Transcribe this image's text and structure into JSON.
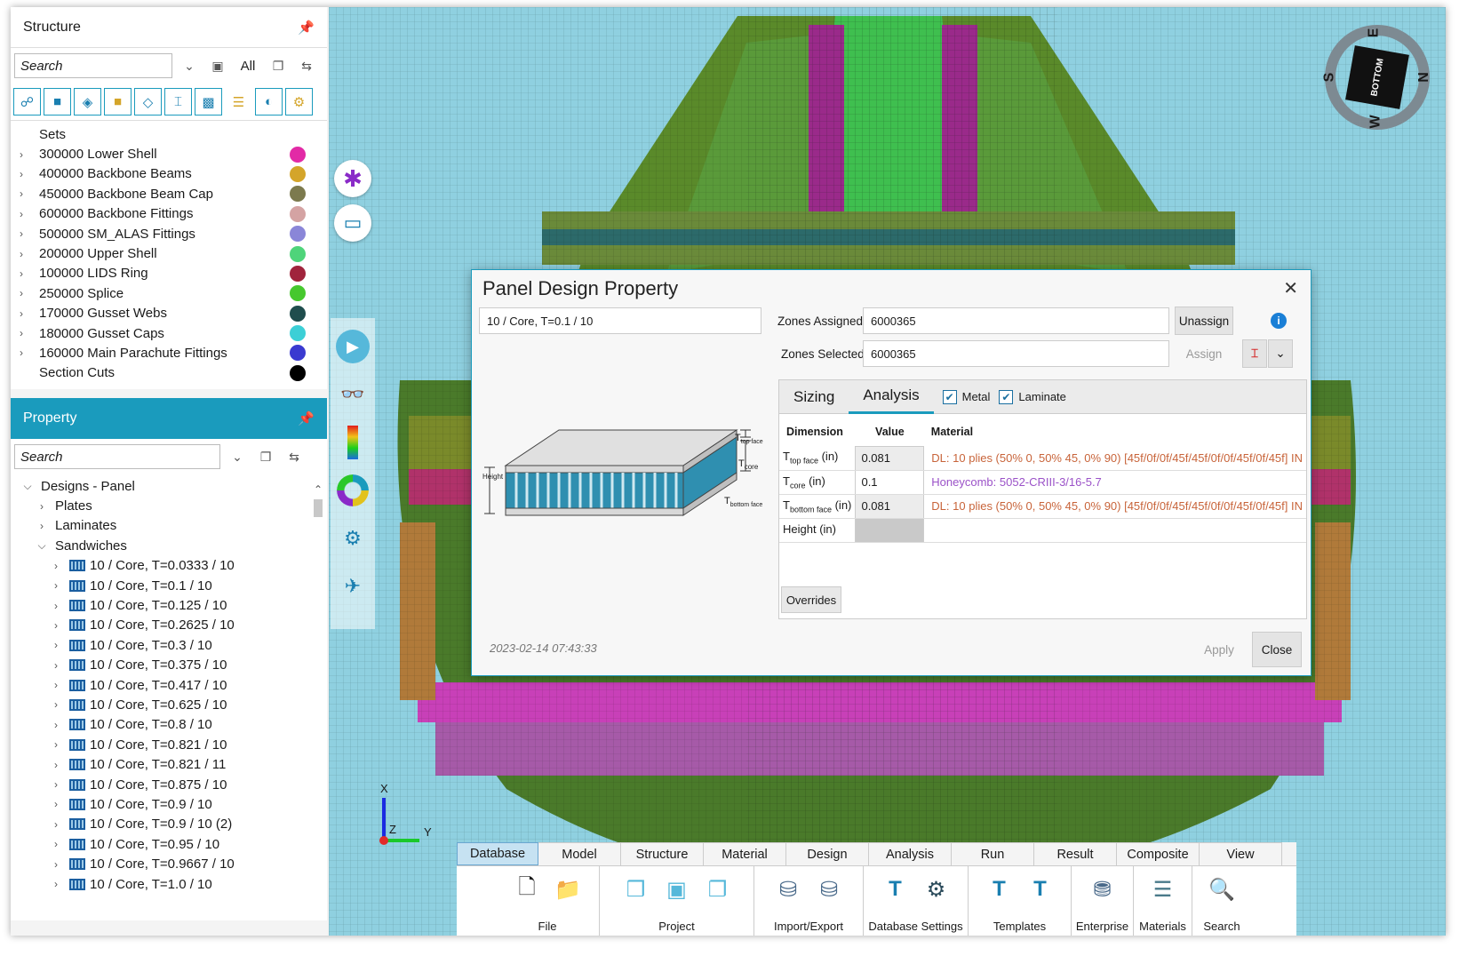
{
  "structure": {
    "title": "Structure",
    "search_placeholder": "Search",
    "all_label": "All",
    "sets_root": "Sets",
    "sets": [
      {
        "label": "300000 Lower Shell",
        "color": "#e22aa6"
      },
      {
        "label": "400000 Backbone Beams",
        "color": "#d4a52a"
      },
      {
        "label": "450000 Backbone Beam Cap",
        "color": "#7c7a4e"
      },
      {
        "label": "600000 Backbone Fittings",
        "color": "#d4a3a3"
      },
      {
        "label": "500000 SM_ALAS Fittings",
        "color": "#8a86d8"
      },
      {
        "label": "200000 Upper Shell",
        "color": "#4fd47a"
      },
      {
        "label": "100000 LIDS Ring",
        "color": "#a0243c"
      },
      {
        "label": "250000 Splice",
        "color": "#46c82e"
      },
      {
        "label": "170000 Gusset Webs",
        "color": "#1f4d4d"
      },
      {
        "label": "180000 Gusset Caps",
        "color": "#3ccfd6"
      },
      {
        "label": "160000 Main Parachute Fittings",
        "color": "#3a3ad0"
      },
      {
        "label": "Section Cuts",
        "color": "#000000"
      }
    ]
  },
  "property": {
    "title": "Property",
    "search_placeholder": "Search",
    "root": "Designs - Panel",
    "groups": [
      "Plates",
      "Laminates",
      "Sandwiches"
    ],
    "sandwiches": [
      "10 / Core, T=0.0333 / 10",
      "10 / Core, T=0.1 / 10",
      "10 / Core, T=0.125 / 10",
      "10 / Core, T=0.2625 / 10",
      "10 / Core, T=0.3 / 10",
      "10 / Core, T=0.375 / 10",
      "10 / Core, T=0.417 / 10",
      "10 / Core, T=0.625 / 10",
      "10 / Core, T=0.8 / 10",
      "10 / Core, T=0.821 / 10",
      "10 / Core, T=0.821 / 11",
      "10 / Core, T=0.875 / 10",
      "10 / Core, T=0.9 / 10",
      "10 / Core, T=0.9 / 10 (2)",
      "10 / Core, T=0.95 / 10",
      "10 / Core, T=0.9667 / 10",
      "10 / Core, T=1.0 / 10"
    ]
  },
  "dialog": {
    "title": "Panel Design Property",
    "name": "10 / Core, T=0.1 / 10",
    "zones_assigned_label": "Zones Assigned:",
    "zones_assigned_value": "6000365",
    "zones_selected_label": "Zones Selected:",
    "zones_selected_value": "6000365",
    "unassign_label": "Unassign",
    "assign_label": "Assign",
    "tabs": [
      "Sizing",
      "Analysis"
    ],
    "active_tab": "Analysis",
    "metal_label": "Metal",
    "laminate_label": "Laminate",
    "columns": [
      "Dimension",
      "Value",
      "Material"
    ],
    "rows": [
      {
        "dim": "T",
        "sub": "top face",
        "unit": " (in)",
        "value": "0.081",
        "material": "DL: 10 plies (50% 0, 50% 45, 0% 90) [45f/0f/0f/45f/45f/0f/0f/45f/0f/45f] IN",
        "mat_color": "orange"
      },
      {
        "dim": "T",
        "sub": "core",
        "unit": " (in)",
        "value": "0.1",
        "material": "Honeycomb: 5052-CRIII-3/16-5.7",
        "mat_color": "purple"
      },
      {
        "dim": "T",
        "sub": "bottom face",
        "unit": " (in)",
        "value": "0.081",
        "material": "DL: 10 plies (50% 0, 50% 45, 0% 90) [45f/0f/0f/45f/45f/0f/0f/45f/0f/45f] IN",
        "mat_color": "orange"
      },
      {
        "dim": "Height",
        "sub": "",
        "unit": " (in)",
        "value": "",
        "material": "",
        "mat_color": "none"
      }
    ],
    "overrides_label": "Overrides",
    "timestamp": "2023-02-14 07:43:33",
    "apply_label": "Apply",
    "close_label": "Close",
    "diagram_labels": {
      "top": "T",
      "top_sub": "top face",
      "core": "T",
      "core_sub": "core",
      "bottom": "T",
      "bottom_sub": "bottom face",
      "height": "Height"
    }
  },
  "ribbon": {
    "tabs": [
      "Database",
      "Model",
      "Structure",
      "Material",
      "Design",
      "Analysis",
      "Run",
      "Result",
      "Composite",
      "View"
    ],
    "active_tab": "Database",
    "groups": [
      "File",
      "Project",
      "Import/Export",
      "Database Settings",
      "Templates",
      "Enterprise",
      "Materials",
      "Search"
    ]
  },
  "compass": {
    "label": "BOTTOM",
    "n": "N",
    "s": "S",
    "e": "E",
    "w": "W"
  },
  "triad": {
    "x": "X",
    "y": "Y",
    "z": "Z"
  }
}
